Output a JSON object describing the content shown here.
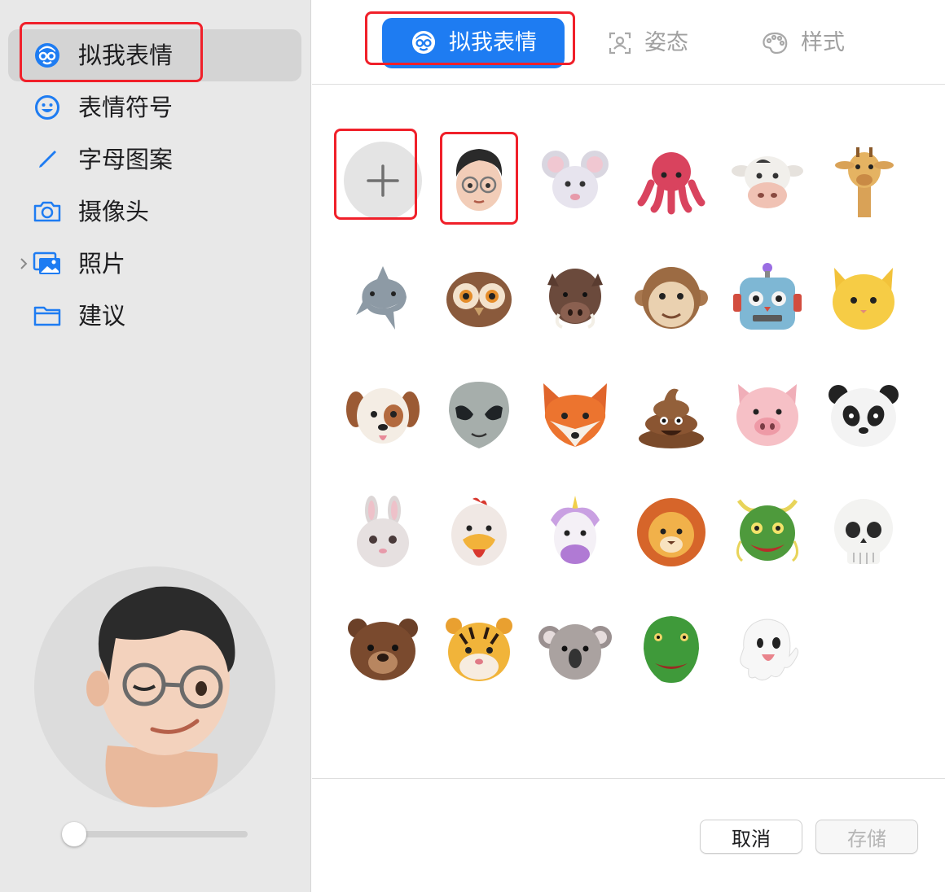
{
  "sidebar": {
    "items": [
      {
        "label": "拟我表情",
        "icon": "memoji-icon"
      },
      {
        "label": "表情符号",
        "icon": "smiley-icon"
      },
      {
        "label": "字母图案",
        "icon": "pencil-icon"
      },
      {
        "label": "摄像头",
        "icon": "camera-icon"
      },
      {
        "label": "照片",
        "icon": "photos-icon"
      },
      {
        "label": "建议",
        "icon": "folder-icon"
      }
    ],
    "selected_index": 0,
    "zoom_slider_fraction": 0.0
  },
  "tabs": [
    {
      "label": "拟我表情",
      "icon": "memoji-icon",
      "active": true
    },
    {
      "label": "姿态",
      "icon": "pose-icon",
      "active": false
    },
    {
      "label": "样式",
      "icon": "palette-icon",
      "active": false
    }
  ],
  "grid": {
    "items": [
      "add-new",
      "memoji-glasses-guy",
      "mouse",
      "octopus",
      "cow",
      "giraffe",
      "shark",
      "owl",
      "boar",
      "monkey",
      "robot",
      "cat",
      "dog",
      "alien",
      "fox",
      "poop",
      "pig",
      "panda",
      "rabbit",
      "chicken",
      "unicorn",
      "lion",
      "dragon",
      "skull",
      "bear",
      "tiger",
      "koala",
      "t-rex",
      "ghost"
    ]
  },
  "buttons": {
    "cancel": "取消",
    "save": "存储"
  },
  "colors": {
    "accent": "#1e7cf2",
    "highlight": "#f0202a",
    "sidebar_bg": "#e8e8e8"
  }
}
